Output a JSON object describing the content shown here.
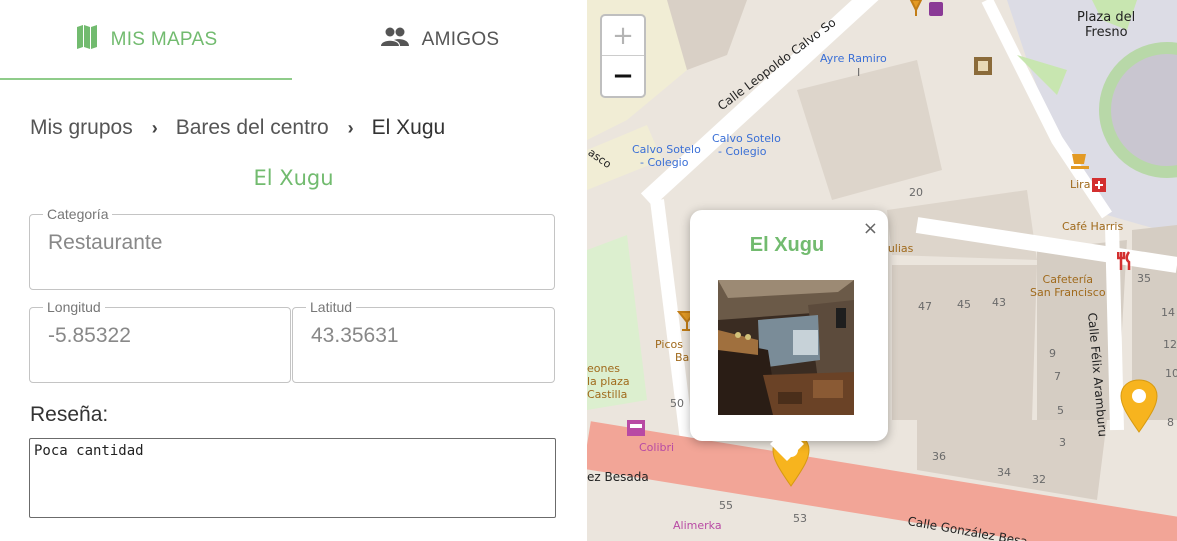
{
  "tabs": {
    "maps_label": "MIS MAPAS",
    "friends_label": "AMIGOS",
    "active": "maps",
    "accent_color": "#72bb6f"
  },
  "breadcrumb": {
    "items": [
      "Mis grupos",
      "Bares del centro",
      "El Xugu"
    ],
    "separator": "›"
  },
  "place": {
    "title": "El Xugu",
    "category_label": "Categoría",
    "category_value": "Restaurante",
    "longitude_label": "Longitud",
    "longitude_value": "-5.85322",
    "latitude_label": "Latitud",
    "latitude_value": "43.35631",
    "review_label": "Reseña:",
    "review_value": "Poca cantidad"
  },
  "map": {
    "zoom_in": "+",
    "zoom_out": "−",
    "popup": {
      "title": "El Xugu",
      "close": "×",
      "photo_icon": "bar-interior-photo"
    },
    "marker_color": "#f7b41e",
    "labels": {
      "plaza_del_fresno_1": "Plaza del",
      "plaza_del_fresno_2": "Fresno",
      "ayre_ramiro": "Ayre Ramiro",
      "calle_leopoldo": "Calle Leopoldo Calvo So",
      "calvo_sotelo_a_1": "Calvo Sotelo",
      "calvo_sotelo_a_2": "- Colegio",
      "calvo_sotelo_b_1": "Calvo Sotelo",
      "calvo_sotelo_b_2": "- Colegio",
      "asco": "asco",
      "tertulias": "rtulias",
      "lira": "Lira",
      "cafe_harris": "Café Harris",
      "cafeteria_1": "Cafetería",
      "cafeteria_2": "San Francisco",
      "calle_felix": "Calle Félix Aramburu",
      "picos_1": "Picos",
      "picos_2": "Ba",
      "leones_1": "eones",
      "leones_2": "la plaza",
      "leones_3": "Castilla",
      "colibri": "Colibri",
      "ez_besada": "ez Besada",
      "alimerka": "Alimerka",
      "calle_gonzalez": "Calle González Besa"
    },
    "house_numbers": [
      "20",
      "47",
      "45",
      "43",
      "35",
      "14",
      "9",
      "12",
      "7",
      "10",
      "5",
      "8",
      "3",
      "36",
      "34",
      "32",
      "50",
      "55",
      "53",
      "I"
    ]
  }
}
